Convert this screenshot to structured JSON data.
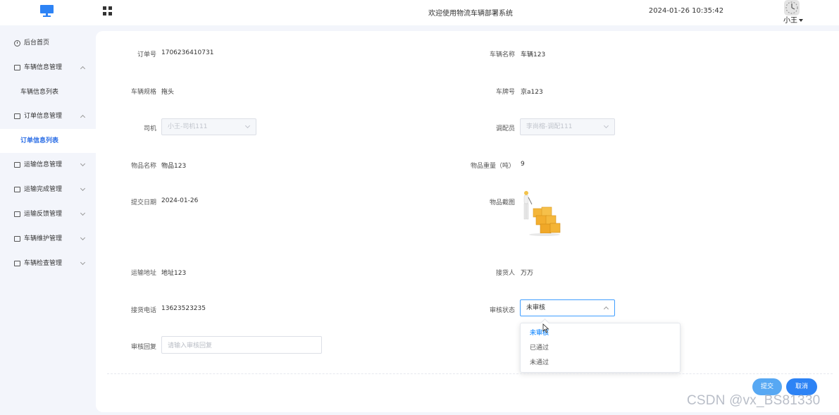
{
  "header": {
    "system_title": "欢迎使用物流车辆部署系统",
    "datetime": "2024-01-26 10:35:42",
    "username": "小王"
  },
  "sidebar": {
    "items": [
      {
        "label": "后台首页",
        "icon": "clock-icon"
      },
      {
        "label": "车辆信息管理",
        "icon": "folder-icon",
        "expanded": true,
        "children": [
          {
            "label": "车辆信息列表"
          }
        ]
      },
      {
        "label": "订单信息管理",
        "icon": "folder-icon",
        "expanded": true,
        "children": [
          {
            "label": "订单信息列表",
            "active": true
          }
        ]
      },
      {
        "label": "运输信息管理",
        "icon": "folder-icon",
        "expanded": false
      },
      {
        "label": "运输完成管理",
        "icon": "folder-icon",
        "expanded": false
      },
      {
        "label": "运输反馈管理",
        "icon": "folder-icon",
        "expanded": false
      },
      {
        "label": "车辆维护管理",
        "icon": "folder-icon",
        "expanded": false
      },
      {
        "label": "车辆检查管理",
        "icon": "folder-icon",
        "expanded": false
      }
    ]
  },
  "form": {
    "order_no": {
      "label": "订单号",
      "value": "1706236410731"
    },
    "vehicle_name": {
      "label": "车辆名称",
      "value": "车辆123"
    },
    "vehicle_spec": {
      "label": "车辆规格",
      "value": "拖头"
    },
    "plate_no": {
      "label": "车牌号",
      "value": "京a123"
    },
    "driver": {
      "label": "司机",
      "value": "小王-司机111"
    },
    "dispatcher": {
      "label": "调配员",
      "value": "李尚榕-调配111"
    },
    "goods_name": {
      "label": "物品名称",
      "value": "物品123"
    },
    "goods_weight": {
      "label": "物品重量（吨）",
      "value": "9"
    },
    "submit_date": {
      "label": "提交日期",
      "value": "2024-01-26"
    },
    "goods_image": {
      "label": "物品截图"
    },
    "address": {
      "label": "运输地址",
      "value": "地址123"
    },
    "receiver": {
      "label": "接货人",
      "value": "万万"
    },
    "receiver_phone": {
      "label": "接货电话",
      "value": "13623523235"
    },
    "review_status": {
      "label": "审核状态",
      "value": "未审核",
      "options": [
        "未审核",
        "已通过",
        "未通过"
      ]
    },
    "review_reply": {
      "label": "审核回复",
      "placeholder": "请输入审核回复"
    }
  },
  "actions": {
    "submit": "提交",
    "cancel": "取消"
  },
  "watermark": "CSDN @vx_BS81330",
  "colors": {
    "primary": "#2d83f5",
    "submit": "#57a8f3",
    "active_text": "#2d6fe6",
    "background": "#f3f5fb"
  }
}
